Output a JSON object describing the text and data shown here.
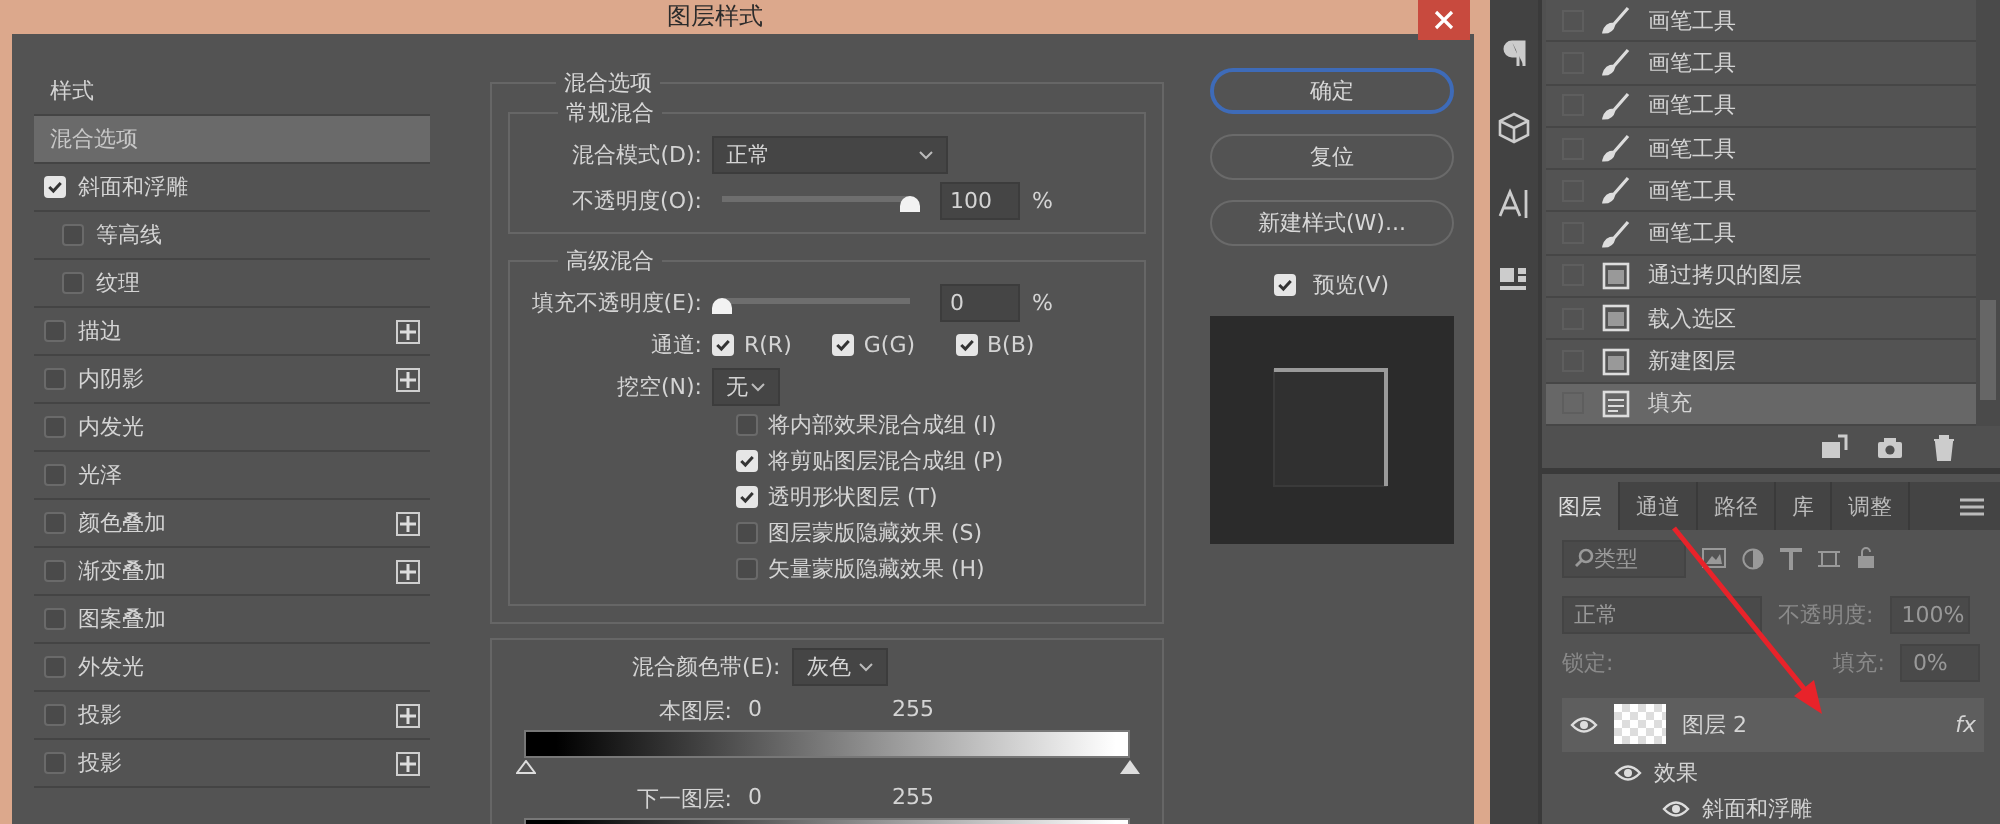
{
  "dialog": {
    "title": "图层样式",
    "styles": [
      {
        "label": "样式",
        "kind": "header"
      },
      {
        "label": "混合选项",
        "kind": "item",
        "selected": true
      },
      {
        "label": "斜面和浮雕",
        "kind": "check",
        "checked": true,
        "selected": false,
        "addable": false
      },
      {
        "label": "等高线",
        "kind": "subcheck",
        "checked": false,
        "selected": false,
        "addable": false
      },
      {
        "label": "纹理",
        "kind": "subcheck",
        "checked": false,
        "selected": false,
        "addable": false
      },
      {
        "label": "描边",
        "kind": "check",
        "checked": false,
        "selected": false,
        "addable": true
      },
      {
        "label": "内阴影",
        "kind": "check",
        "checked": false,
        "selected": false,
        "addable": true
      },
      {
        "label": "内发光",
        "kind": "check",
        "checked": false,
        "selected": false,
        "addable": false
      },
      {
        "label": "光泽",
        "kind": "check",
        "checked": false,
        "selected": false,
        "addable": false
      },
      {
        "label": "颜色叠加",
        "kind": "check",
        "checked": false,
        "selected": false,
        "addable": true
      },
      {
        "label": "渐变叠加",
        "kind": "check",
        "checked": false,
        "selected": false,
        "addable": true
      },
      {
        "label": "图案叠加",
        "kind": "check",
        "checked": false,
        "selected": false,
        "addable": false
      },
      {
        "label": "外发光",
        "kind": "check",
        "checked": false,
        "selected": false,
        "addable": false
      },
      {
        "label": "投影",
        "kind": "check",
        "checked": false,
        "selected": false,
        "addable": true
      },
      {
        "label": "投影",
        "kind": "check",
        "checked": false,
        "selected": false,
        "addable": true
      }
    ],
    "blending": {
      "legend": "混合选项",
      "general": {
        "legend": "常规混合",
        "mode_label": "混合模式(D):",
        "mode": "正常",
        "opacity_label": "不透明度(O):",
        "level": 1,
        "opacity": "100",
        "unit": "%"
      },
      "advanced": {
        "legend": "高级混合",
        "fill_label": "填充不透明度(E):",
        "level": 0,
        "fill": "0",
        "unit": "%",
        "channels_label": "通道:",
        "channels": [
          {
            "label": "R(R)",
            "checked": true
          },
          {
            "label": "G(G)",
            "checked": true
          },
          {
            "label": "B(B)",
            "checked": true
          }
        ],
        "knockout_label": "挖空(N):",
        "knockout": "无",
        "options": [
          {
            "label": "将内部效果混合成组 (I)",
            "checked": false
          },
          {
            "label": "将剪贴图层混合成组 (P)",
            "checked": true
          },
          {
            "label": "透明形状图层 (T)",
            "checked": true
          },
          {
            "label": "图层蒙版隐藏效果 (S)",
            "checked": false
          },
          {
            "label": "矢量蒙版隐藏效果 (H)",
            "checked": false
          }
        ]
      },
      "blend_if": {
        "label": "混合颜色带(E):",
        "value": "灰色",
        "bands": [
          {
            "label": "本图层:",
            "low": "0",
            "high": "255"
          },
          {
            "label": "下一图层:",
            "low": "0",
            "high": "255"
          }
        ]
      }
    },
    "buttons": [
      {
        "label": "确定",
        "kind": "default"
      },
      {
        "label": "复位",
        "kind": "normal"
      },
      {
        "label": "新建样式(W)...",
        "kind": "normal"
      }
    ],
    "preview": {
      "label": "预览(V)",
      "checked": true
    }
  },
  "history": {
    "items": [
      {
        "label": "画笔工具",
        "kind": "brush",
        "selected": false
      },
      {
        "label": "画笔工具",
        "kind": "brush",
        "selected": false
      },
      {
        "label": "画笔工具",
        "kind": "brush",
        "selected": false
      },
      {
        "label": "画笔工具",
        "kind": "brush",
        "selected": false
      },
      {
        "label": "画笔工具",
        "kind": "brush",
        "selected": false
      },
      {
        "label": "画笔工具",
        "kind": "brush",
        "selected": false
      },
      {
        "label": "通过拷贝的图层",
        "kind": "doc",
        "selected": false
      },
      {
        "label": "载入选区",
        "kind": "doc",
        "selected": false
      },
      {
        "label": "新建图层",
        "kind": "doc",
        "selected": false
      },
      {
        "label": "填充",
        "kind": "fill",
        "selected": true
      }
    ]
  },
  "layers": {
    "tabs": [
      {
        "label": "图层",
        "selected": true
      },
      {
        "label": "通道",
        "selected": false
      },
      {
        "label": "路径",
        "selected": false
      },
      {
        "label": "库",
        "selected": false
      },
      {
        "label": "调整",
        "selected": false
      }
    ],
    "filter": "类型",
    "blend": "正常",
    "opacity_label": "不透明度:",
    "opacity": "100%",
    "lock_label": "锁定:",
    "fill_label": "填充:",
    "fill": "0%",
    "layer": {
      "name": "图层 2",
      "fx": "fx",
      "effects_label": "效果",
      "effect": "斜面和浮雕"
    }
  }
}
